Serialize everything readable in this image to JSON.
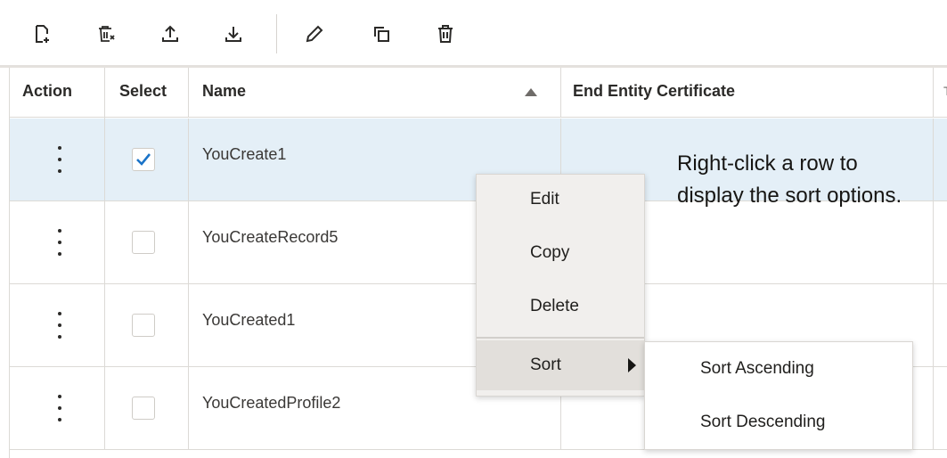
{
  "toolbar": {
    "buttons": [
      {
        "name": "create-icon"
      },
      {
        "name": "bulk-delete-icon"
      },
      {
        "name": "upload-icon"
      },
      {
        "name": "download-icon"
      },
      {
        "name": "edit-icon"
      },
      {
        "name": "copy-icon"
      },
      {
        "name": "delete-icon"
      }
    ]
  },
  "table": {
    "headers": {
      "action": "Action",
      "select": "Select",
      "name": "Name",
      "certificate": "End Entity Certificate",
      "truncated": "T"
    },
    "sort_indicator": "ascending",
    "rows": [
      {
        "name": "YouCreate1",
        "selected": true
      },
      {
        "name": "YouCreateRecord5",
        "selected": false
      },
      {
        "name": "YouCreated1",
        "selected": false
      },
      {
        "name": "YouCreatedProfile2",
        "selected": false
      }
    ]
  },
  "annotation": {
    "text": "Right-click a row to display the sort options."
  },
  "context_menu": {
    "items": [
      "Edit",
      "Copy",
      "Delete"
    ],
    "sort_label": "Sort",
    "submenu": [
      "Sort Ascending",
      "Sort Descending"
    ]
  },
  "colors": {
    "selected_row": "#e4eff7",
    "check_accent": "#1a73c8",
    "menu_bg": "#f1efed"
  }
}
